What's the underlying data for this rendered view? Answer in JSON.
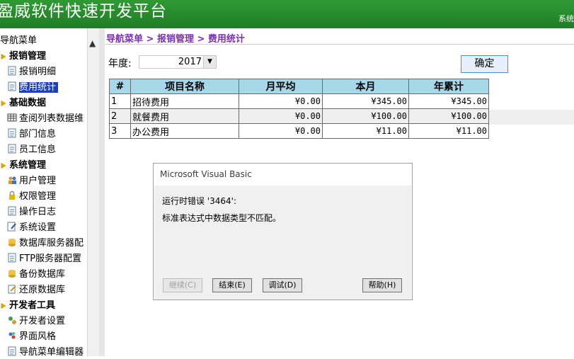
{
  "header": {
    "title": "盈威软件快速开发平台",
    "sys_text": "系统"
  },
  "nav": {
    "title": "导航菜单",
    "items": [
      {
        "label": "报销管理",
        "type": "group",
        "icon": "folder-icon"
      },
      {
        "label": "报销明细",
        "type": "item",
        "icon": "document-icon"
      },
      {
        "label": "费用统计",
        "type": "item",
        "icon": "document-icon",
        "selected": true
      },
      {
        "label": "基础数据",
        "type": "group",
        "icon": "folder-icon"
      },
      {
        "label": "查阅列表数据维",
        "type": "item",
        "icon": "grid-icon"
      },
      {
        "label": "部门信息",
        "type": "item",
        "icon": "document-icon"
      },
      {
        "label": "员工信息",
        "type": "item",
        "icon": "document-icon"
      },
      {
        "label": "系统管理",
        "type": "group",
        "icon": "folder-icon"
      },
      {
        "label": "用户管理",
        "type": "item",
        "icon": "users-icon"
      },
      {
        "label": "权限管理",
        "type": "item",
        "icon": "lock-icon"
      },
      {
        "label": "操作日志",
        "type": "item",
        "icon": "document-icon"
      },
      {
        "label": "系统设置",
        "type": "item",
        "icon": "settings-icon"
      },
      {
        "label": "数据库服务器配",
        "type": "item",
        "icon": "database-icon"
      },
      {
        "label": "FTP服务器配置",
        "type": "item",
        "icon": "document-icon"
      },
      {
        "label": "备份数据库",
        "type": "item",
        "icon": "database-icon"
      },
      {
        "label": "还原数据库",
        "type": "item",
        "icon": "restore-icon"
      },
      {
        "label": "开发者工具",
        "type": "group",
        "icon": "folder-icon"
      },
      {
        "label": "开发者设置",
        "type": "item",
        "icon": "gears-icon"
      },
      {
        "label": "界面风格",
        "type": "item",
        "icon": "style-icon"
      },
      {
        "label": "导航菜单编辑器",
        "type": "item",
        "icon": "document-icon"
      }
    ]
  },
  "breadcrumb": "导航菜单 > 报销管理 > 费用统计",
  "filter": {
    "year_label": "年度:",
    "year_value": "2017",
    "ok_label": "确定"
  },
  "table": {
    "headers": [
      "#",
      "项目名称",
      "月平均",
      "本月",
      "年累计"
    ],
    "rows": [
      [
        "1",
        "招待费用",
        "¥0.00",
        "¥345.00",
        "¥345.00"
      ],
      [
        "2",
        "就餐费用",
        "¥0.00",
        "¥100.00",
        "¥100.00"
      ],
      [
        "3",
        "办公费用",
        "¥0.00",
        "¥11.00",
        "¥11.00"
      ]
    ]
  },
  "dialog": {
    "title": "Microsoft Visual Basic",
    "line1": "运行时错误 '3464':",
    "line2": "标准表达式中数据类型不匹配。",
    "buttons": {
      "continue": "继续(C)",
      "end": "结束(E)",
      "debug": "调试(D)",
      "help": "帮助(H)"
    }
  },
  "colors": {
    "header": "#1f8a28",
    "selected": "#1a3fbf",
    "table_header": "#a6d8ea",
    "breadcrumb": "#7a2fb5"
  }
}
